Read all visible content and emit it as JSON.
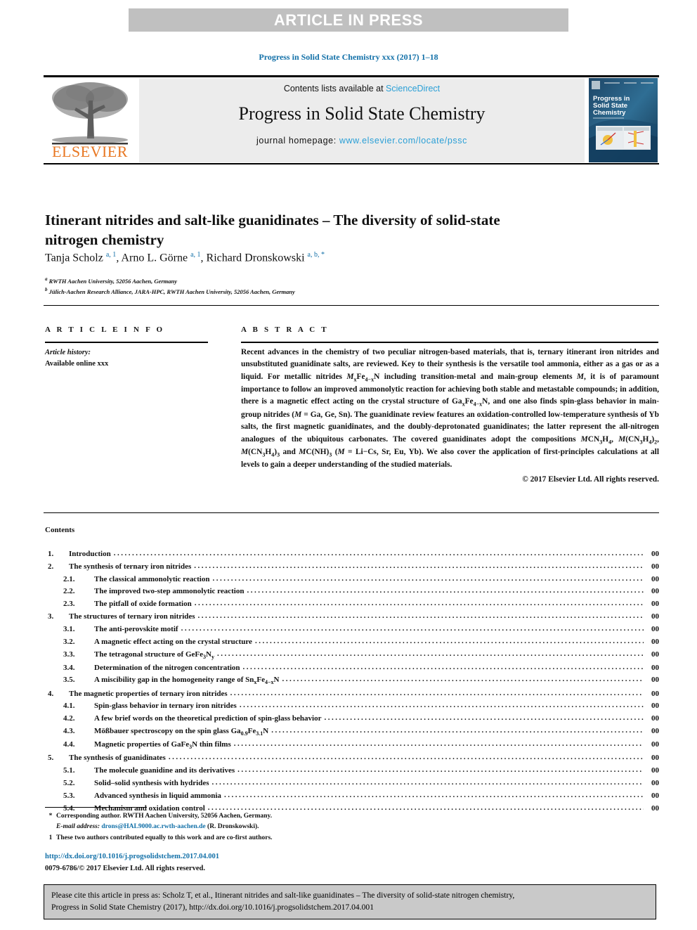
{
  "banner": {
    "text": "ARTICLE IN PRESS"
  },
  "running_head": "Progress in Solid State Chemistry xxx (2017) 1–18",
  "journal_header": {
    "publisher": "ELSEVIER",
    "contents_prefix": "Contents lists available at ",
    "contents_link": "ScienceDirect",
    "journal_title": "Progress in Solid State Chemistry",
    "homepage_prefix": "journal homepage: ",
    "homepage_url": "www.elsevier.com/locate/pssc",
    "cover_title_line1": "Progress in",
    "cover_title_line2": "Solid State",
    "cover_title_line3": "Chemistry"
  },
  "article": {
    "title": "Itinerant nitrides and salt-like guanidinates – The diversity of solid-state nitrogen chemistry",
    "authors_html": "Tanja Scholz <sup>a, 1</sup>, Arno L. Görne <sup>a, 1</sup>, Richard Dronskowski <sup>a, b, *</sup>",
    "affiliations": [
      {
        "mark": "a",
        "text": "RWTH Aachen University, 52056 Aachen, Germany"
      },
      {
        "mark": "b",
        "text": "Jülich-Aachen Research Alliance, JARA-HPC, RWTH Aachen University, 52056 Aachen, Germany"
      }
    ]
  },
  "article_info": {
    "heading": "A R T I C L E  I N F O",
    "history_label": "Article history:",
    "history_value": "Available online xxx"
  },
  "abstract": {
    "heading": "A B S T R A C T",
    "body_html": "Recent advances in the chemistry of two peculiar nitrogen-based materials, that is, ternary itinerant iron nitrides and unsubstituted guanidinate salts, are reviewed. Key to their synthesis is the versatile tool ammonia, either as a gas or as a liquid. For metallic nitrides <i>M</i><sub>x</sub>Fe<sub>4−x</sub>N including transition-metal and main-group elements <i>M</i>, it is of paramount importance to follow an improved ammonolytic reaction for achieving both stable and metastable compounds; in addition, there is a magnetic effect acting on the crystal structure of Ga<sub>x</sub>Fe<sub>4−x</sub>N, and one also finds spin-glass behavior in main-group nitrides (<i>M</i> = Ga, Ge, Sn). The guanidinate review features an oxidation-controlled low-temperature synthesis of Yb salts, the first magnetic guanidinates, and the doubly-deprotonated guanidinates; the latter represent the all-nitrogen analogues of the ubiquitous carbonates. The covered guanidinates adopt the compositions <i>M</i>CN<sub>3</sub>H<sub>4</sub>, <i>M</i>(CN<sub>3</sub>H<sub>4</sub>)<sub>2</sub>, <i>M</i>(CN<sub>3</sub>H<sub>4</sub>)<sub>3</sub> and <i>M</i>C(NH)<sub>3</sub> (<i>M</i> = Li−Cs, Sr, Eu, Yb). We also cover the application of first-principles calculations at all levels to gain a deeper understanding of the studied materials.",
    "copyright": "© 2017 Elsevier Ltd. All rights reserved."
  },
  "contents": {
    "label": "Contents",
    "entries": [
      {
        "num": "1.",
        "label_html": "Introduction",
        "page": "00",
        "sub": false
      },
      {
        "num": "2.",
        "label_html": "The synthesis of ternary iron nitrides",
        "page": "00",
        "sub": false
      },
      {
        "num": "2.1.",
        "label_html": "The classical ammonolytic reaction",
        "page": "00",
        "sub": true
      },
      {
        "num": "2.2.",
        "label_html": "The improved two-step ammonolytic reaction",
        "page": "00",
        "sub": true
      },
      {
        "num": "2.3.",
        "label_html": "The pitfall of oxide formation",
        "page": "00",
        "sub": true
      },
      {
        "num": "3.",
        "label_html": "The structures of ternary iron nitrides",
        "page": "00",
        "sub": false
      },
      {
        "num": "3.1.",
        "label_html": "The anti-perovskite motif",
        "page": "00",
        "sub": true
      },
      {
        "num": "3.2.",
        "label_html": "A magnetic effect acting on the crystal structure",
        "page": "00",
        "sub": true
      },
      {
        "num": "3.3.",
        "label_html": "The tetragonal structure of GeFe<sub>3</sub>N<sub>y</sub>",
        "page": "00",
        "sub": true
      },
      {
        "num": "3.4.",
        "label_html": "Determination of the nitrogen concentration",
        "page": "00",
        "sub": true
      },
      {
        "num": "3.5.",
        "label_html": "A miscibility gap in the homogeneity range of Sn<sub>x</sub>Fe<sub>4−x</sub>N",
        "page": "00",
        "sub": true
      },
      {
        "num": "4.",
        "label_html": "The magnetic properties of ternary iron nitrides",
        "page": "00",
        "sub": false
      },
      {
        "num": "4.1.",
        "label_html": "Spin-glass behavior in ternary iron nitrides",
        "page": "00",
        "sub": true
      },
      {
        "num": "4.2.",
        "label_html": "A few brief words on the theoretical prediction of spin-glass behavior",
        "page": "00",
        "sub": true
      },
      {
        "num": "4.3.",
        "label_html": "Mößbauer spectroscopy on the spin glass Ga<sub>0.9</sub>Fe<sub>3.1</sub>N",
        "page": "00",
        "sub": true
      },
      {
        "num": "4.4.",
        "label_html": "Magnetic properties of GaFe<sub>3</sub>N thin films",
        "page": "00",
        "sub": true
      },
      {
        "num": "5.",
        "label_html": "The synthesis of guanidinates",
        "page": "00",
        "sub": false
      },
      {
        "num": "5.1.",
        "label_html": "The molecule guanidine and its derivatives",
        "page": "00",
        "sub": true
      },
      {
        "num": "5.2.",
        "label_html": "Solid–solid synthesis with hydrides",
        "page": "00",
        "sub": true
      },
      {
        "num": "5.3.",
        "label_html": "Advanced synthesis in liquid ammonia",
        "page": "00",
        "sub": true
      },
      {
        "num": "5.4.",
        "label_html": "Mechanism and oxidation control",
        "page": "00",
        "sub": true
      }
    ]
  },
  "footnotes": {
    "corresponding_mark": "*",
    "corresponding_text": "Corresponding author. RWTH Aachen University, 52056 Aachen, Germany.",
    "email_label": "E-mail address:",
    "email": "drons@HAL9000.ac.rwth-aachen.de",
    "email_suffix": "(R. Dronskowski).",
    "equal_mark": "1",
    "equal_text": "These two authors contributed equally to this work and are co-first authors."
  },
  "doi_block": {
    "doi_url": "http://dx.doi.org/10.1016/j.progsolidstchem.2017.04.001",
    "issn_line": "0079-6786/© 2017 Elsevier Ltd. All rights reserved."
  },
  "citation_box": {
    "line1": "Please cite this article in press as: Scholz T, et al., Itinerant nitrides and salt-like guanidinates – The diversity of solid-state nitrogen chemistry,",
    "line2": "Progress in Solid State Chemistry (2017), http://dx.doi.org/10.1016/j.progsolidstchem.2017.04.001"
  },
  "colors": {
    "banner_bg": "#c0c0c0",
    "link_blue": "#1270a8",
    "sciencedirect_blue": "#2a9fd6",
    "elsevier_orange": "#e87722",
    "band_gray": "#ececec",
    "cite_box_bg": "#c9c9c9"
  }
}
